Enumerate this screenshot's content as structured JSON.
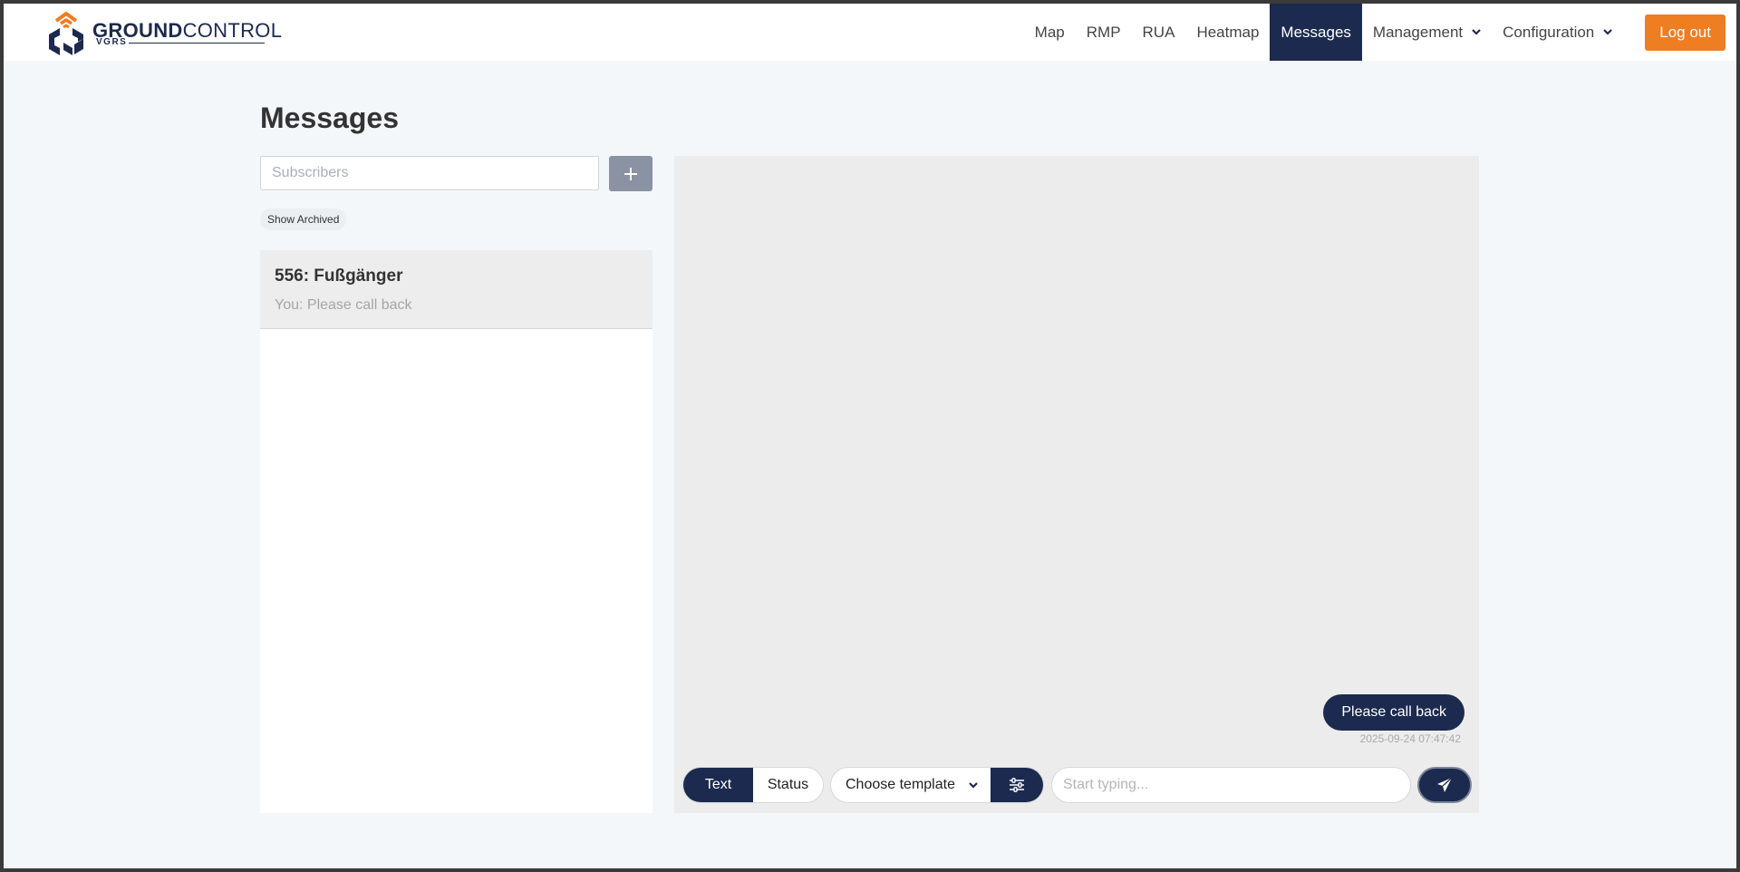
{
  "brand": {
    "name_bold": "GROUND",
    "name_light": "CONTROL",
    "sub": "VGRS",
    "colors": {
      "navy": "#1b2a4e",
      "orange": "#ef7d22"
    }
  },
  "nav": {
    "items": [
      {
        "label": "Map"
      },
      {
        "label": "RMP"
      },
      {
        "label": "RUA"
      },
      {
        "label": "Heatmap"
      },
      {
        "label": "Messages",
        "active": true
      },
      {
        "label": "Management",
        "dropdown": true
      },
      {
        "label": "Configuration",
        "dropdown": true
      }
    ],
    "logout_label": "Log out"
  },
  "page": {
    "title": "Messages"
  },
  "sidebar": {
    "search_placeholder": "Subscribers",
    "add_icon": "plus-icon",
    "show_archived_label": "Show Archived",
    "conversations": [
      {
        "name": "556: Fußgänger",
        "preview": "You: Please call back"
      }
    ]
  },
  "chat": {
    "messages": [
      {
        "text": "Please call back",
        "timestamp": "2025-09-24 07:47:42",
        "from_me": true
      }
    ],
    "composer": {
      "mode_options": [
        "Text",
        "Status"
      ],
      "mode_selected": "Text",
      "template_label": "Choose template",
      "filter_icon": "sliders-icon",
      "input_placeholder": "Start typing...",
      "send_icon": "paper-plane-icon"
    }
  }
}
